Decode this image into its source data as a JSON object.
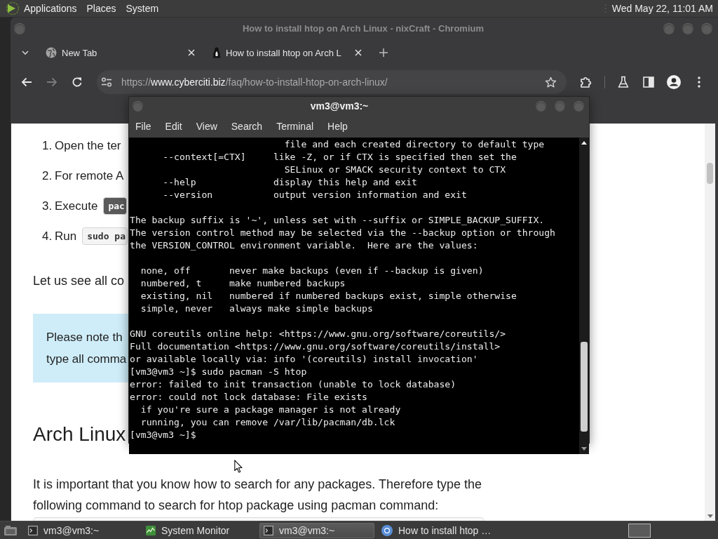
{
  "top_panel": {
    "menus": [
      "Applications",
      "Places",
      "System"
    ],
    "clock": "Wed May 22, 11:01 AM"
  },
  "browser": {
    "title": "How to install htop on Arch Linux - nixCraft - Chromium",
    "focused": false,
    "tabs": [
      {
        "label": "New Tab",
        "kind": "newtab"
      },
      {
        "label": "How to install htop on Arch L",
        "kind": "site"
      }
    ],
    "nav": [
      {
        "kind": "back",
        "disabled": false
      },
      {
        "kind": "forward",
        "disabled": true
      },
      {
        "kind": "reload",
        "disabled": false
      }
    ],
    "address": {
      "scheme": "https://",
      "host": "www.cyberciti.biz",
      "path": "/faq/how-to-install-htop-on-arch-linux/"
    },
    "page": {
      "steps": [
        {
          "number": "1.",
          "text": "Open the ter"
        },
        {
          "number": "2.",
          "text": "For remote A"
        },
        {
          "number": "3.",
          "text": "Execute",
          "code": {
            "text": "pac",
            "highlighted": true
          }
        },
        {
          "number": "4.",
          "text": "Run",
          "code": {
            "text": "sudo pa",
            "highlighted": false
          }
        }
      ],
      "intro": "Let us see all co",
      "note": {
        "lines": [
          "Please note th",
          "type all comma"
        ]
      },
      "heading": "Arch Linux",
      "paragraph": "It is important that you know how to search for any packages. Therefore type the following command to search for htop package using pacman command:"
    }
  },
  "terminal": {
    "title": "vm3@vm3:~",
    "focused": true,
    "menus": [
      "File",
      "Edit",
      "View",
      "Search",
      "Terminal",
      "Help"
    ],
    "blocks": [
      [
        "                            file and each created directory to default type",
        "      --context[=CTX]     like -Z, or if CTX is specified then set the",
        "                            SELinux or SMACK security context to CTX",
        "      --help              display this help and exit",
        "      --version           output version information and exit"
      ],
      [
        "The backup suffix is '~', unless set with --suffix or SIMPLE_BACKUP_SUFFIX.",
        "The version control method may be selected via the --backup option or through",
        "the VERSION_CONTROL environment variable.  Here are the values:"
      ],
      [
        "  none, off       never make backups (even if --backup is given)",
        "  numbered, t     make numbered backups",
        "  existing, nil   numbered if numbered backups exist, simple otherwise",
        "  simple, never   always make simple backups"
      ],
      [
        "GNU coreutils online help: <https://www.gnu.org/software/coreutils/>",
        "Full documentation <https://www.gnu.org/software/coreutils/install>",
        "or available locally via: info '(coreutils) install invocation'",
        "[vm3@vm3 ~]$ sudo pacman -S htop",
        "error: failed to init transaction (unable to lock database)",
        "error: could not lock database: File exists",
        "  if you're sure a package manager is not already",
        "  running, you can remove /var/lib/pacman/db.lck",
        "[vm3@vm3 ~]$"
      ]
    ]
  },
  "taskbar": {
    "items": [
      {
        "label": "vm3@vm3:~",
        "kind": "terminal",
        "selected": false
      },
      {
        "label": "System Monitor",
        "kind": "monitor",
        "selected": false
      },
      {
        "label": "vm3@vm3:~",
        "kind": "terminal",
        "selected": true
      },
      {
        "label": "How to install htop …",
        "kind": "browser",
        "selected": false
      }
    ]
  }
}
